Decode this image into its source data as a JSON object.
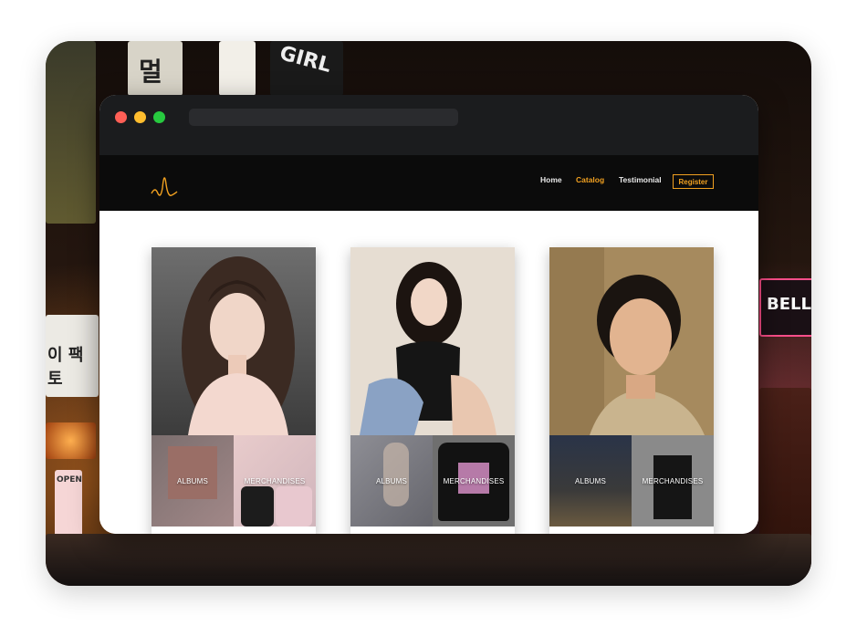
{
  "chrome": {
    "traffic_lights": [
      "#ff5f56",
      "#ffbd2e",
      "#27c93f"
    ]
  },
  "nav": {
    "logo_icon": "waveform-logo-icon",
    "links": [
      {
        "label": "Home",
        "active": false
      },
      {
        "label": "Catalog",
        "active": true
      },
      {
        "label": "Testimonial",
        "active": false
      }
    ],
    "register_label": "Register"
  },
  "colors": {
    "accent": "#f0a020",
    "nav_bg": "#0b0b0b",
    "chrome_bg": "#1b1c1e"
  },
  "cards": [
    {
      "albums_label": "ALBUMS",
      "merch_label": "MERCHANDISES"
    },
    {
      "albums_label": "ALBUMS",
      "merch_label": "MERCHANDISES"
    },
    {
      "albums_label": "ALBUMS",
      "merch_label": "MERCHANDISES"
    }
  ],
  "background_signs": {
    "korean_text_1": "멀",
    "korean_text_2": "이 팩 토",
    "korean_text_3": "OPEN",
    "english_text": "GIRL",
    "right_sign": "BELL"
  }
}
